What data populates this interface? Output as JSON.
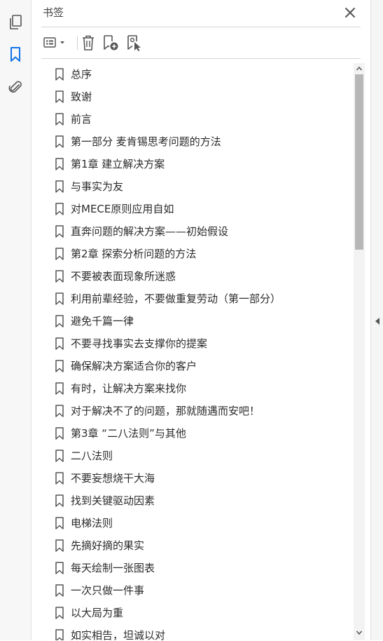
{
  "panel": {
    "title": "书签"
  },
  "rail": {
    "items": [
      {
        "name": "pages-icon"
      },
      {
        "name": "bookmarks-icon"
      },
      {
        "name": "attachments-icon"
      }
    ]
  },
  "colors": {
    "accent": "#1473e6",
    "icon": "#555555",
    "text": "#2b2b2b"
  },
  "bookmarks": [
    "总序",
    "致谢",
    "前言",
    "第一部分 麦肯锡思考问题的方法",
    "第1章 建立解决方案",
    "与事实为友",
    "对MECE原则应用自如",
    "直奔问题的解决方案——初始假设",
    "第2章 探索分析问题的方法",
    "不要被表面现象所迷惑",
    "利用前辈经验，不要做重复劳动（第一部分）",
    "避免千篇一律",
    "不要寻找事实去支撑你的提案",
    "确保解决方案适合你的客户",
    "有时，让解决方案来找你",
    "对于解决不了的问题，那就随遇而安吧！",
    "第3章 “二八法则”与其他",
    "二八法则",
    "不要妄想烧干大海",
    "找到关键驱动因素",
    "电梯法则",
    "先摘好摘的果实",
    "每天绘制一张图表",
    "一次只做一件事",
    "以大局为重",
    "如实相告，坦诚以对"
  ]
}
